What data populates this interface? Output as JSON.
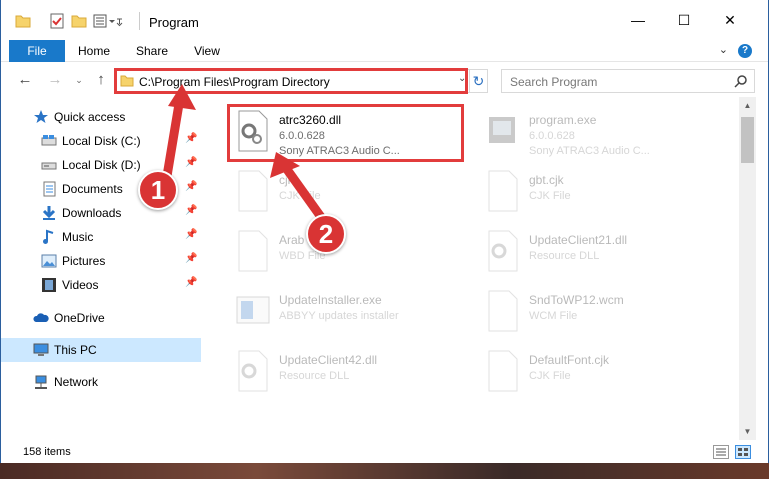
{
  "window": {
    "title": "Program",
    "controls": {
      "minimize": "—",
      "maximize": "☐",
      "close": "✕"
    }
  },
  "ribbon": {
    "tabs": [
      "File",
      "Home",
      "Share",
      "View"
    ],
    "help": "?"
  },
  "address_bar": {
    "path": "C:\\Program Files\\Program Directory"
  },
  "search": {
    "placeholder": "Search Program"
  },
  "sidebar": {
    "items": [
      {
        "label": "Quick access",
        "icon": "star-icon"
      },
      {
        "label": "Local Disk (C:)",
        "icon": "drive-icon",
        "pinned": true
      },
      {
        "label": "Local Disk (D:)",
        "icon": "drive-icon",
        "pinned": true
      },
      {
        "label": "Documents",
        "icon": "documents-icon",
        "pinned": true
      },
      {
        "label": "Downloads",
        "icon": "download-icon",
        "pinned": true
      },
      {
        "label": "Music",
        "icon": "music-icon",
        "pinned": true
      },
      {
        "label": "Pictures",
        "icon": "pictures-icon",
        "pinned": true
      },
      {
        "label": "Videos",
        "icon": "videos-icon",
        "pinned": true
      },
      {
        "label": "OneDrive",
        "icon": "cloud-icon"
      },
      {
        "label": "This PC",
        "icon": "computer-icon",
        "selected": true
      },
      {
        "label": "Network",
        "icon": "network-icon"
      }
    ]
  },
  "files": [
    {
      "name": "atrc3260.dll",
      "line2": "6.0.0.628",
      "line3": "Sony ATRAC3 Audio C...",
      "icon": "dll-gear-icon",
      "highlight": true
    },
    {
      "name": "program.exe",
      "line2": "6.0.0.628",
      "line3": "Sony ATRAC3 Audio C...",
      "icon": "exe-icon"
    },
    {
      "name": "cjk",
      "line2": "CJK File",
      "line3": "",
      "icon": "file-icon"
    },
    {
      "name": "gbt.cjk",
      "line2": "CJK File",
      "line3": "",
      "icon": "file-icon"
    },
    {
      "name": "Arab",
      "line2": "WBD File",
      "line3": "",
      "icon": "file-icon"
    },
    {
      "name": "UpdateClient21.dll",
      "line2": "Resource DLL",
      "line3": "",
      "icon": "dll-gear-icon"
    },
    {
      "name": "UpdateInstaller.exe",
      "line2": "ABBYY updates installer",
      "line3": "",
      "icon": "installer-icon"
    },
    {
      "name": "SndToWP12.wcm",
      "line2": "WCM File",
      "line3": "",
      "icon": "file-icon"
    },
    {
      "name": "UpdateClient42.dll",
      "line2": "Resource DLL",
      "line3": "",
      "icon": "dll-gear-icon"
    },
    {
      "name": "DefaultFont.cjk",
      "line2": "CJK File",
      "line3": "",
      "icon": "file-icon"
    }
  ],
  "status": {
    "item_count": "158 items"
  },
  "annotations": [
    {
      "number": "1"
    },
    {
      "number": "2"
    }
  ],
  "colors": {
    "accent": "#1979ca",
    "highlight_border": "#e23c3c",
    "badge": "#d93434",
    "selected_bg": "#cce8ff"
  }
}
